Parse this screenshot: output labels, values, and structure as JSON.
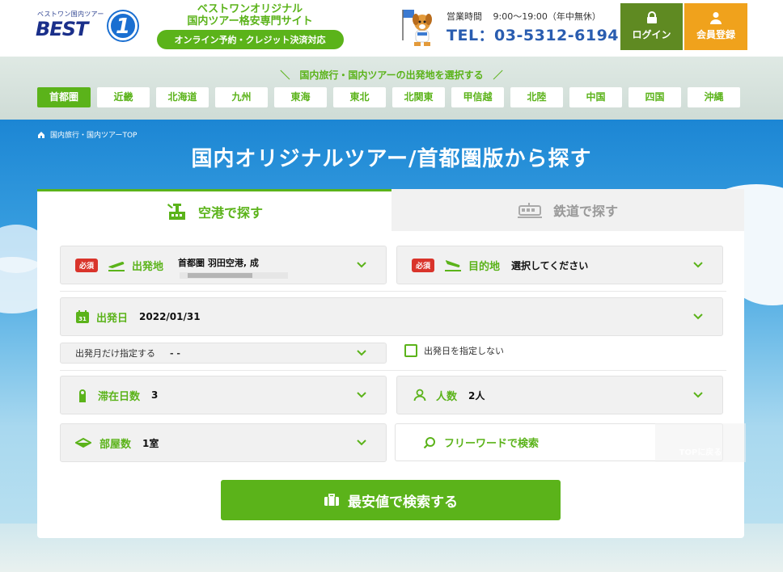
{
  "header": {
    "logo_top": "ベストワン国内ツアー",
    "logo_main": "BEST",
    "logo_num": "1",
    "tagline_1": "ベストワンオリジナル",
    "tagline_2": "国内ツアー格安専門サイト",
    "tagline_pill": "オンライン予約・クレジット決済対応",
    "hours_label": "営業時間",
    "hours_value": "9:00～19:00（年中無休）",
    "phone": "TEL：03-5312-6194",
    "login_label": "ログイン",
    "member_label": "会員登録",
    "colors": {
      "green": "#5bb31a",
      "login_bg": "#5f8a22",
      "member_bg": "#f0a21c",
      "phone": "#2a5db0"
    }
  },
  "regions": {
    "title": "＼　国内旅行・国内ツアーの出発地を選択する　／",
    "items": [
      "首都圏",
      "近畿",
      "北海道",
      "九州",
      "東海",
      "東北",
      "北関東",
      "甲信越",
      "北陸",
      "中国",
      "四国",
      "沖縄"
    ],
    "active": "首都圏"
  },
  "hero": {
    "breadcrumb": "国内旅行・国内ツアーTOP",
    "title": "国内オリジナルツアー/首都圏版から探す"
  },
  "search": {
    "tab_air": "空港で探す",
    "tab_rail": "鉄道で探す",
    "required_badge": "必須",
    "departure_label": "出発地",
    "departure_value": "首都圏 羽田空港, 成",
    "destination_label": "目的地",
    "destination_value": "選択してください",
    "date_label": "出発日",
    "date_value": "2022/01/31",
    "month_only_label": "出発月だけ指定する",
    "month_only_value": "- -",
    "no_date_label": "出発日を指定しない",
    "stay_label": "滞在日数",
    "stay_value": "3",
    "people_label": "人数",
    "people_value": "2人",
    "rooms_label": "部屋数",
    "rooms_value": "1室",
    "freeword_label": "フリーワードで検索",
    "totop_label": "TOPに戻る",
    "submit_label": "最安値で検索する",
    "calendar_day": "31"
  }
}
